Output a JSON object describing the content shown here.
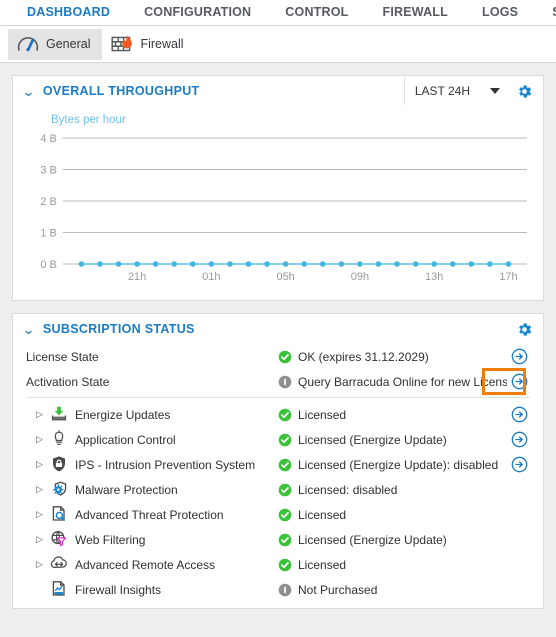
{
  "topnav": {
    "items": [
      {
        "label": "DASHBOARD",
        "active": true
      },
      {
        "label": "CONFIGURATION",
        "active": false
      },
      {
        "label": "CONTROL",
        "active": false
      },
      {
        "label": "FIREWALL",
        "active": false
      },
      {
        "label": "LOGS",
        "active": false
      },
      {
        "label": "STATISTICS",
        "active": false
      }
    ]
  },
  "tabs": [
    {
      "label": "General",
      "icon": "gauge-icon",
      "selected": true
    },
    {
      "label": "Firewall",
      "icon": "firewall-flame-icon",
      "selected": false
    }
  ],
  "throughput": {
    "title": "OVERALL THROUGHPUT",
    "collapse_icon": "chevron-down-icon",
    "range_label": "LAST 24H",
    "range_caret_icon": "caret-down-icon",
    "settings_icon": "gear-icon",
    "subtitle": "Bytes per hour"
  },
  "chart_data": {
    "type": "line",
    "title": "OVERALL THROUGHPUT",
    "subtitle": "Bytes per hour",
    "xlabel": "",
    "ylabel": "Bytes per hour",
    "ylim": [
      0,
      4
    ],
    "ytick_labels": [
      "4 B",
      "3 B",
      "2 B",
      "1 B",
      "0 B"
    ],
    "ytick_values": [
      4,
      3,
      2,
      1,
      0
    ],
    "xtick_labels": [
      "21h",
      "01h",
      "05h",
      "09h",
      "13h",
      "17h"
    ],
    "grid": true,
    "legend": "none",
    "line_color": "#5cc0e6",
    "marker_color": "#40b6e0",
    "x": [
      "18h",
      "19h",
      "20h",
      "21h",
      "22h",
      "23h",
      "00h",
      "01h",
      "02h",
      "03h",
      "04h",
      "05h",
      "06h",
      "07h",
      "08h",
      "09h",
      "10h",
      "11h",
      "12h",
      "13h",
      "14h",
      "15h",
      "16h",
      "17h"
    ],
    "series": [
      {
        "name": "Bytes per hour",
        "values": [
          0,
          0,
          0,
          0,
          0,
          0,
          0,
          0,
          0,
          0,
          0,
          0,
          0,
          0,
          0,
          0,
          0,
          0,
          0,
          0,
          0,
          0,
          0,
          0
        ]
      }
    ]
  },
  "subscription": {
    "title": "SUBSCRIPTION STATUS",
    "collapse_icon": "chevron-down-icon",
    "settings_icon": "gear-icon",
    "state_rows": [
      {
        "name": "License State",
        "status_icon": "check-circle-green-icon",
        "value": "OK (expires 31.12.2029)",
        "arrow_icon": "arrow-right-circle-icon",
        "highlighted": false
      },
      {
        "name": "Activation State",
        "status_icon": "info-circle-gray-icon",
        "value": "Query Barracuda Online for new Licenses",
        "arrow_icon": "arrow-right-circle-icon",
        "highlighted": true
      }
    ],
    "features": [
      {
        "name": "Energize Updates",
        "icon": "energize-updates-icon",
        "expandable": true,
        "status_icon": "check-circle-green-icon",
        "value": "Licensed",
        "arrow_icon": "arrow-right-circle-icon"
      },
      {
        "name": "Application Control",
        "icon": "application-control-icon",
        "expandable": true,
        "status_icon": "check-circle-green-icon",
        "value": "Licensed (Energize Update)",
        "arrow_icon": "arrow-right-circle-icon"
      },
      {
        "name": "IPS - Intrusion Prevention System",
        "icon": "ips-shield-icon",
        "expandable": true,
        "status_icon": "check-circle-green-icon",
        "value": "Licensed (Energize Update): disabled",
        "arrow_icon": "arrow-right-circle-icon"
      },
      {
        "name": "Malware Protection",
        "icon": "malware-protection-icon",
        "expandable": true,
        "status_icon": "check-circle-green-icon",
        "value": "Licensed: disabled",
        "arrow_icon": ""
      },
      {
        "name": "Advanced Threat Protection",
        "icon": "advanced-threat-protection-icon",
        "expandable": true,
        "status_icon": "check-circle-green-icon",
        "value": "Licensed",
        "arrow_icon": ""
      },
      {
        "name": "Web Filtering",
        "icon": "web-filtering-icon",
        "expandable": true,
        "status_icon": "check-circle-green-icon",
        "value": "Licensed (Energize Update)",
        "arrow_icon": ""
      },
      {
        "name": "Advanced Remote Access",
        "icon": "advanced-remote-access-icon",
        "expandable": true,
        "status_icon": "check-circle-green-icon",
        "value": "Licensed",
        "arrow_icon": ""
      },
      {
        "name": "Firewall Insights",
        "icon": "firewall-insights-icon",
        "expandable": false,
        "status_icon": "info-circle-gray-icon",
        "value": "Not Purchased",
        "arrow_icon": ""
      }
    ]
  },
  "colors": {
    "accent_blue": "#1a7bc4",
    "status_green": "#3cc13b",
    "status_gray": "#8e8e8e",
    "highlight_orange": "#ef7d0a",
    "chart_line": "#5cc0e6"
  }
}
